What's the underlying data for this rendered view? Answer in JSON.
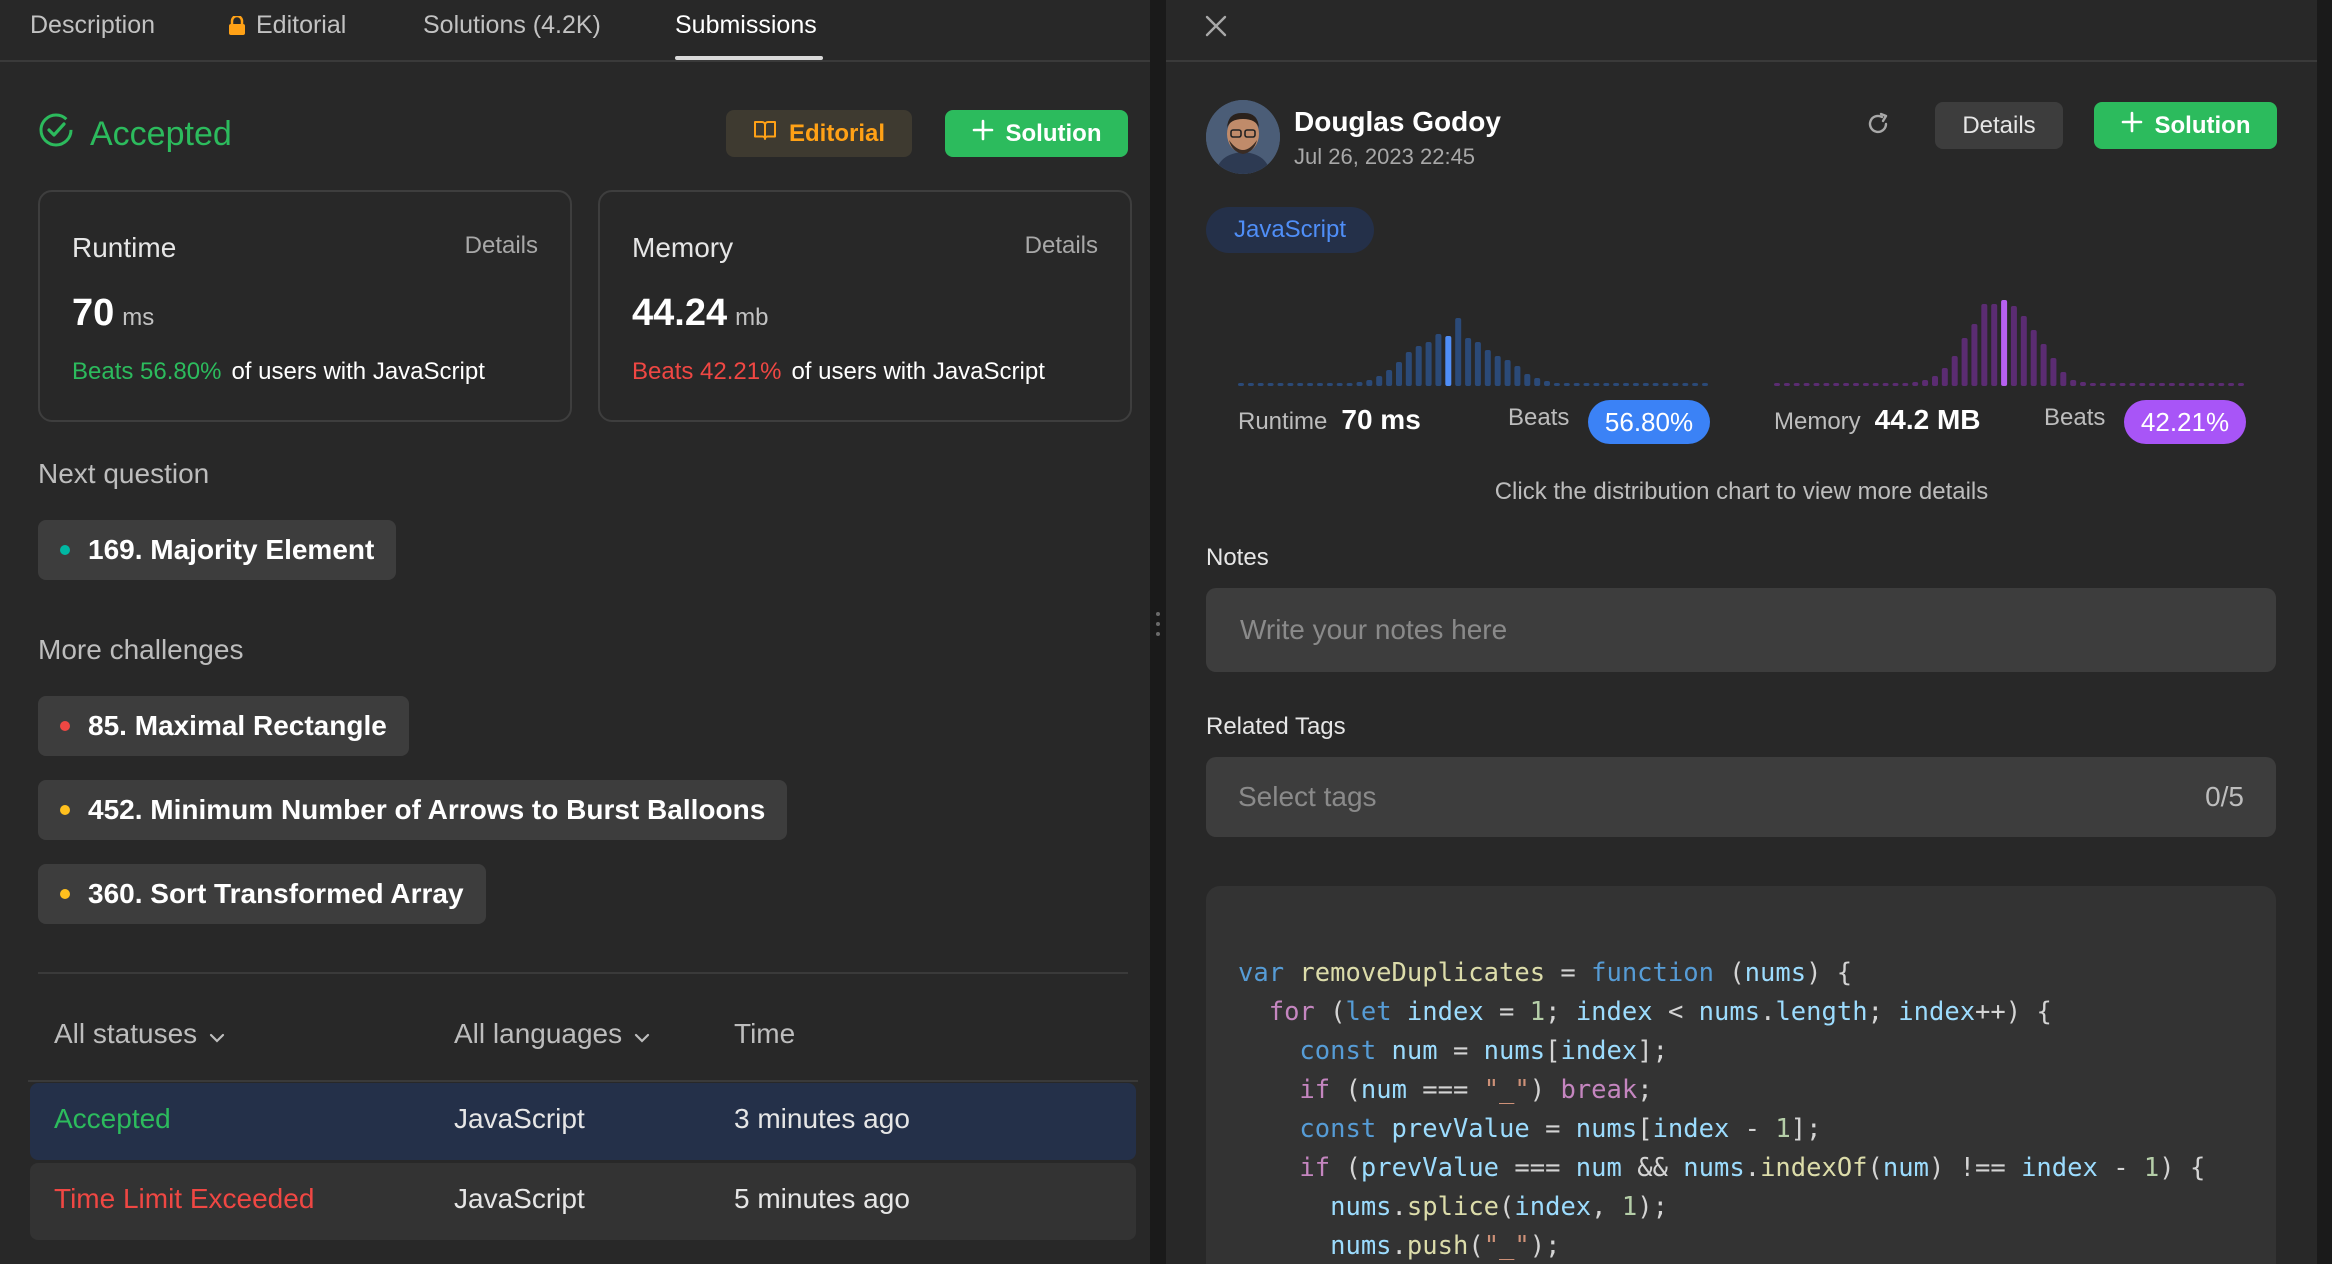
{
  "left": {
    "tabs": [
      {
        "label": "Description"
      },
      {
        "label": "Editorial",
        "icon": "lock-icon"
      },
      {
        "label": "Solutions (4.2K)"
      },
      {
        "label": "Submissions",
        "active": true
      }
    ],
    "status": "Accepted",
    "buttons": {
      "editorial": "Editorial",
      "solution": "Solution"
    },
    "runtime": {
      "label": "Runtime",
      "details": "Details",
      "value": "70",
      "unit": "ms",
      "beats": "Beats 56.80%",
      "suffix": "of users with JavaScript"
    },
    "memory": {
      "label": "Memory",
      "details": "Details",
      "value": "44.24",
      "unit": "mb",
      "beats": "Beats 42.21%",
      "suffix": "of users with JavaScript"
    },
    "next_question": {
      "title": "Next question",
      "item": "169. Majority Element",
      "dot_color": "#00b8a3"
    },
    "more_challenges": {
      "title": "More challenges",
      "items": [
        {
          "label": "85. Maximal Rectangle",
          "dot_color": "#ef4743"
        },
        {
          "label": "452. Minimum Number of Arrows to Burst Balloons",
          "dot_color": "#ffc01e"
        },
        {
          "label": "360. Sort Transformed Array",
          "dot_color": "#ffc01e"
        }
      ]
    },
    "filters": {
      "status": "All statuses",
      "language": "All languages",
      "time": "Time"
    },
    "submissions": [
      {
        "status": "Accepted",
        "language": "JavaScript",
        "time": "3 minutes ago"
      },
      {
        "status": "Time Limit Exceeded",
        "language": "JavaScript",
        "time": "5 minutes ago"
      }
    ]
  },
  "right": {
    "user": {
      "name": "Douglas Godoy",
      "date": "Jul 26, 2023 22:45"
    },
    "buttons": {
      "details": "Details",
      "solution": "Solution"
    },
    "language": "JavaScript",
    "runtime": {
      "label": "Runtime",
      "value": "70 ms",
      "beats_label": "Beats",
      "beats": "56.80%"
    },
    "memory": {
      "label": "Memory",
      "value": "44.2 MB",
      "beats_label": "Beats",
      "beats": "42.21%"
    },
    "hint": "Click the distribution chart to view more details",
    "notes": {
      "label": "Notes",
      "placeholder": "Write your notes here"
    },
    "tags": {
      "label": "Related Tags",
      "placeholder": "Select tags",
      "count": "0/5"
    },
    "code_lines": [
      "var removeDuplicates = function (nums) {",
      "  for (let index = 1; index < nums.length; index++) {",
      "    const num = nums[index];",
      "    if (num === \"_\") break;",
      "    const prevValue = nums[index - 1];",
      "    if (prevValue === num && nums.indexOf(num) !== index - 1) {",
      "      nums.splice(index, 1);",
      "      nums.push(\"_\");"
    ]
  },
  "colors": {
    "green": "#2cbb5d",
    "red": "#ef4743",
    "orange": "#ffa116",
    "blue": "#4f8ef7",
    "purple": "#a855f7"
  }
}
